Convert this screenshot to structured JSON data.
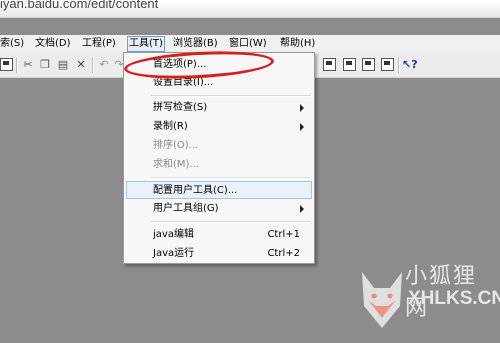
{
  "window": {
    "url": "iyan.baidu.com/edit/content"
  },
  "menubar": {
    "items": [
      {
        "label": "索(S)"
      },
      {
        "label": "文档(D)"
      },
      {
        "label": "工程(P)"
      },
      {
        "label": "工具(T)"
      },
      {
        "label": "浏览器(B)"
      },
      {
        "label": "窗口(W)"
      },
      {
        "label": "帮助(H)"
      }
    ]
  },
  "tools_menu": {
    "items": [
      {
        "label": "首选项(P)..."
      },
      {
        "label": "设置目录(I)..."
      },
      {
        "label": "拼写检查(S)"
      },
      {
        "label": "录制(R)"
      },
      {
        "label": "排序(O)..."
      },
      {
        "label": "求和(M)..."
      },
      {
        "label": "配置用户工具(C)..."
      },
      {
        "label": "用户工具组(G)"
      },
      {
        "label": "java编辑",
        "shortcut": "Ctrl+1"
      },
      {
        "label": "Java运行",
        "shortcut": "Ctrl+2"
      }
    ]
  },
  "watermark": {
    "cn": "小狐狸网",
    "en": "XHLKS.CN"
  },
  "colors": {
    "annotation": "#d81f1f",
    "workspace": "#8c8c8c"
  }
}
